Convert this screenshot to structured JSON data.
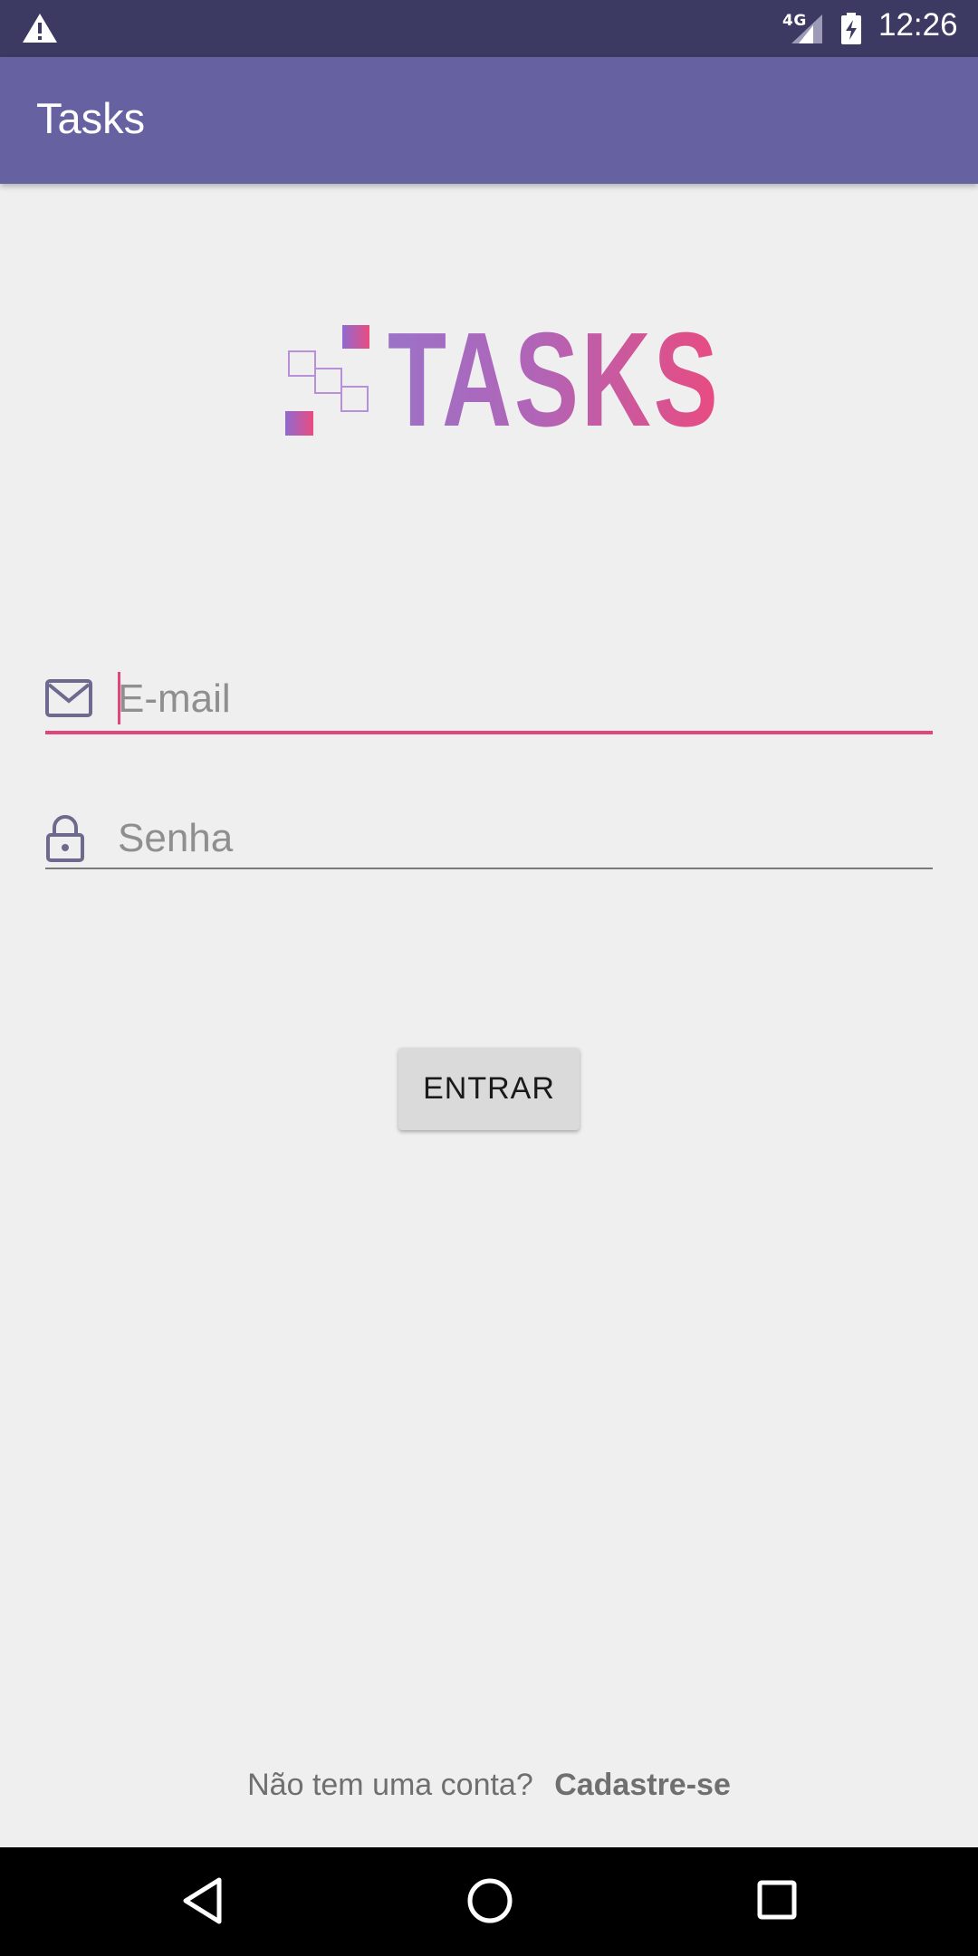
{
  "status_bar": {
    "time": "12:26",
    "network": "4G",
    "icons": [
      "warning-icon",
      "signal-icon",
      "battery-charging-icon"
    ]
  },
  "app_bar": {
    "title": "Tasks"
  },
  "logo": {
    "text": "TASKS"
  },
  "login_form": {
    "email": {
      "placeholder": "E-mail",
      "value": "",
      "icon": "mail-icon"
    },
    "password": {
      "placeholder": "Senha",
      "value": "",
      "icon": "lock-icon"
    },
    "submit_label": "ENTRAR"
  },
  "signup": {
    "prompt": "Não tem uma conta?",
    "link": "Cadastre-se"
  },
  "nav_bar": {
    "icons": [
      "back-icon",
      "home-icon",
      "recents-icon"
    ]
  },
  "colors": {
    "status_bar": "#3c3a62",
    "app_bar": "#6662a2",
    "accent": "#e2457a",
    "background": "#efefef",
    "icon": "#6e6a8e"
  }
}
